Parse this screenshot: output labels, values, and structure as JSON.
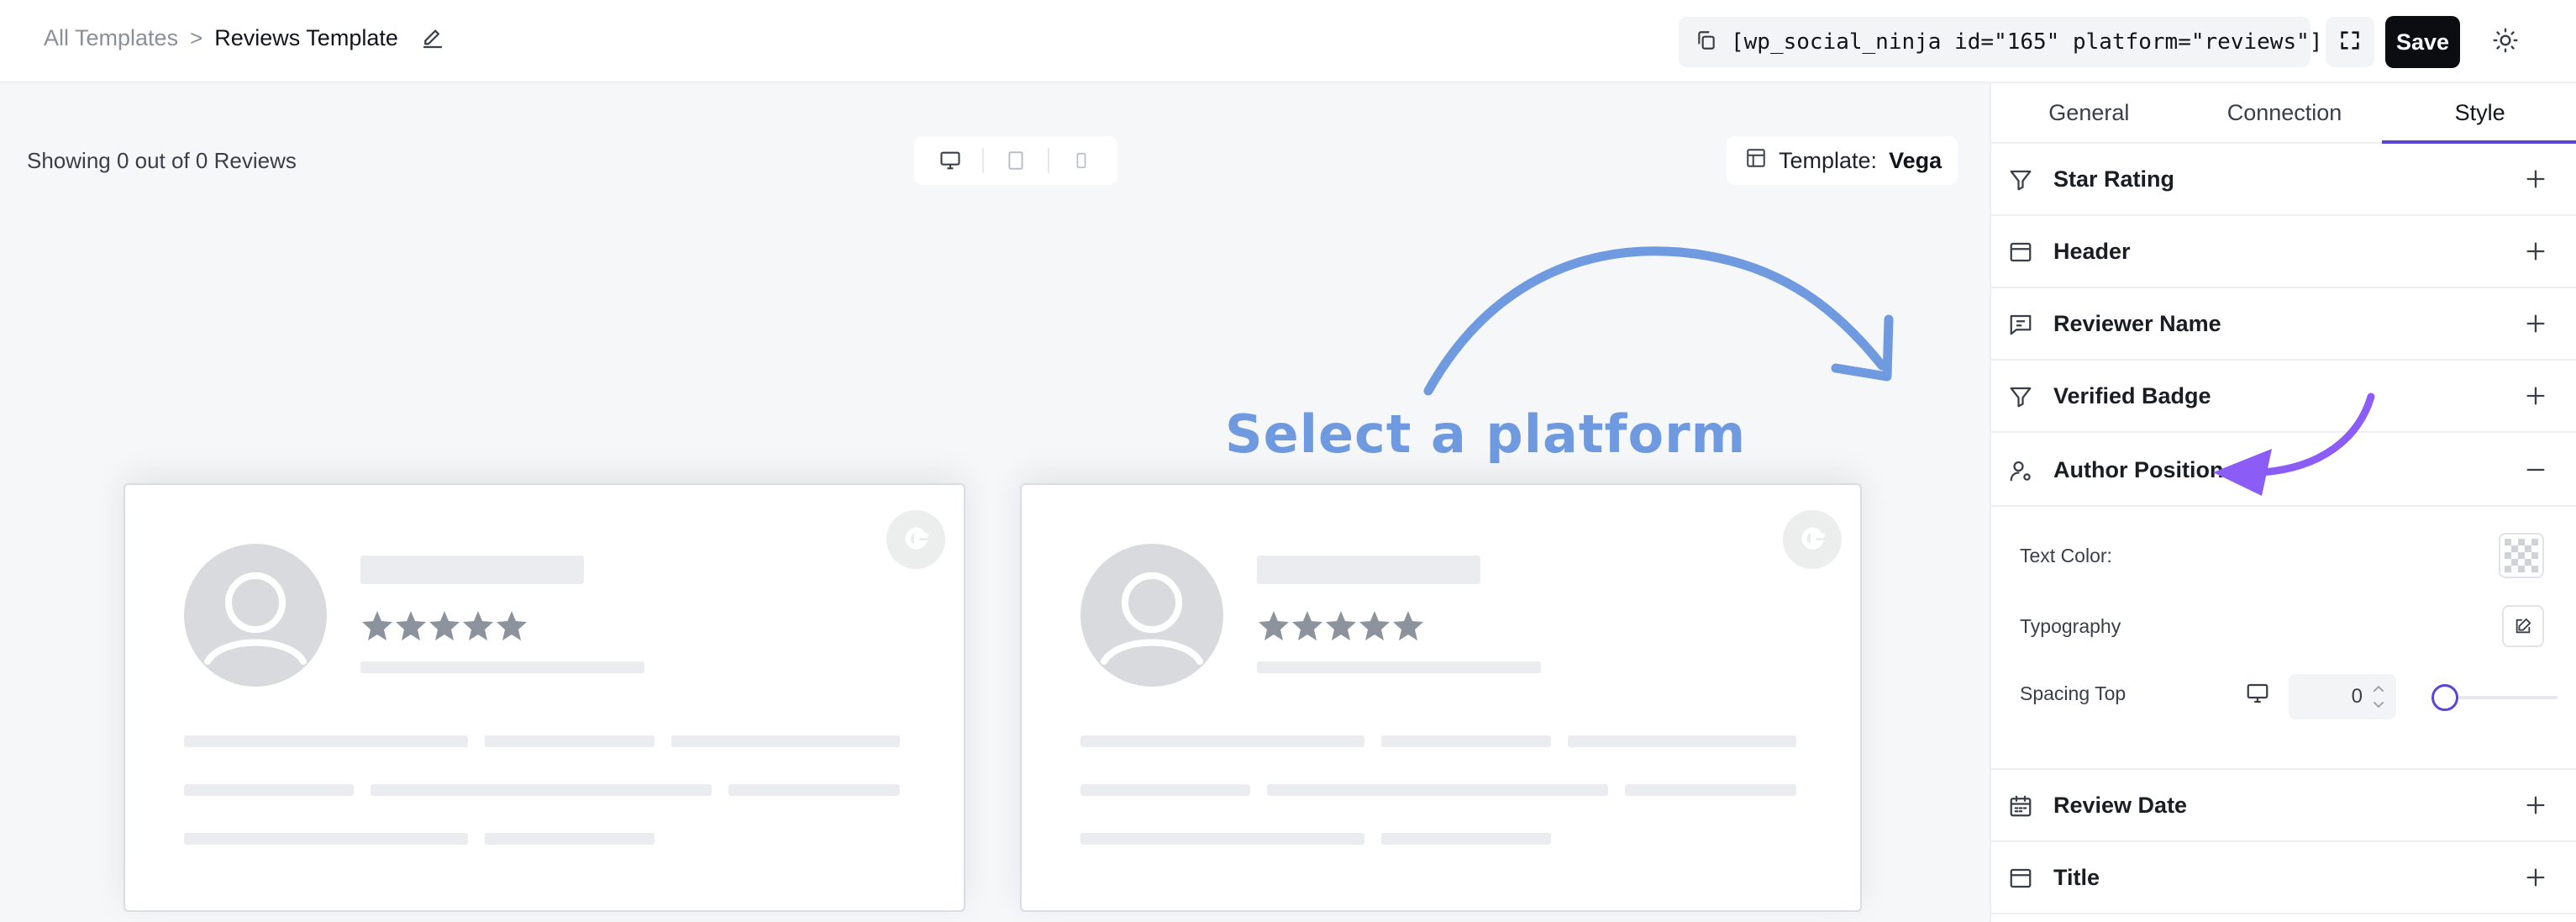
{
  "header": {
    "breadcrumb_root": "All Templates",
    "breadcrumb_separator": ">",
    "breadcrumb_current": "Reviews Template",
    "shortcode": "[wp_social_ninja id=\"165\" platform=\"reviews\"]",
    "save_label": "Save"
  },
  "canvas": {
    "showing_text": "Showing 0 out of 0 Reviews",
    "template_label": "Template:",
    "template_value": "Vega",
    "hint_text": "Select a platform"
  },
  "panel": {
    "tabs": [
      {
        "label": "General",
        "active": false
      },
      {
        "label": "Connection",
        "active": false
      },
      {
        "label": "Style",
        "active": true
      }
    ],
    "sections": [
      {
        "label": "Star Rating",
        "icon": "filter-icon",
        "expanded": false
      },
      {
        "label": "Header",
        "icon": "window-icon",
        "expanded": false
      },
      {
        "label": "Reviewer Name",
        "icon": "message-icon",
        "expanded": false
      },
      {
        "label": "Verified Badge",
        "icon": "filter-icon",
        "expanded": false
      },
      {
        "label": "Author Position",
        "icon": "user-pin-icon",
        "expanded": true
      },
      {
        "label": "Review Date",
        "icon": "calendar-icon",
        "expanded": false
      },
      {
        "label": "Title",
        "icon": "window-icon",
        "expanded": false
      }
    ],
    "author_position": {
      "text_color_label": "Text Color:",
      "typography_label": "Typography",
      "spacing_top_label": "Spacing Top",
      "spacing_top_value": "0"
    }
  },
  "colors": {
    "accent": "#5b45d6",
    "hint_blue": "#6f9ae0",
    "save_bg": "#0b0d10"
  }
}
